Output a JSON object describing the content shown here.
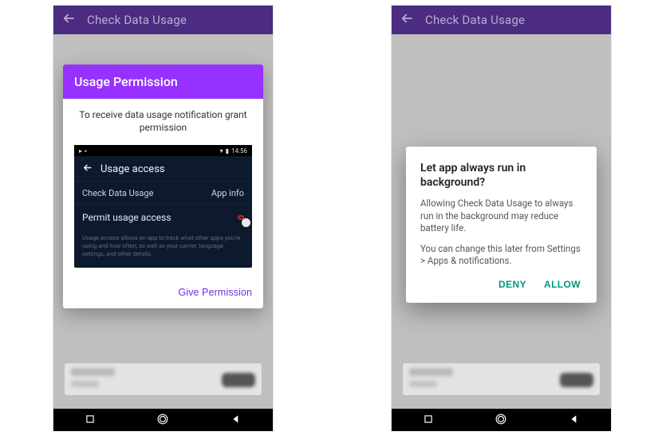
{
  "left": {
    "appbar": {
      "title": "Check Data Usage"
    },
    "dialog": {
      "header": "Usage Permission",
      "desc": "To receive data usage notification grant permission",
      "mock": {
        "time": "14:56",
        "screen_title": "Usage access",
        "app_name": "Check Data Usage",
        "app_info_label": "App info",
        "permit_label": "Permit usage access",
        "hint": "Usage access allows an app to track what other apps you're using and how often, as well as your carrier, language settings, and other details."
      },
      "action": "Give Permission"
    }
  },
  "right": {
    "appbar": {
      "title": "Check Data Usage"
    },
    "dialog": {
      "title": "Let app always run in background?",
      "p1": "Allowing Check Data Usage to always run in the background may reduce battery life.",
      "p2": "You can change this later from Settings > Apps & notifications.",
      "deny": "DENY",
      "allow": "ALLOW"
    }
  }
}
